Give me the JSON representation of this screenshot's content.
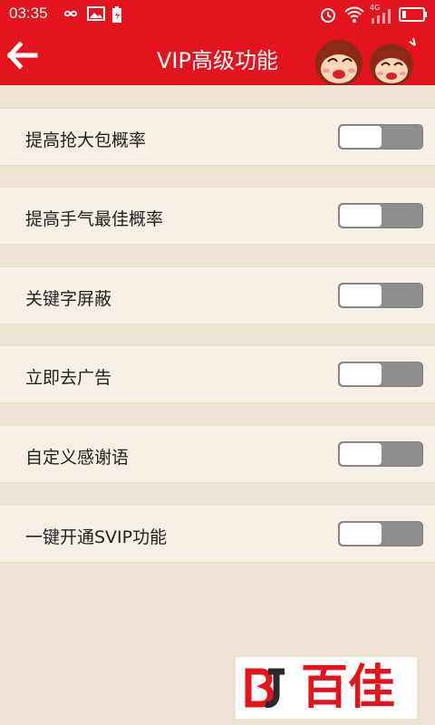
{
  "status_bar": {
    "time": "03:35",
    "network_label": "4G",
    "icons": [
      "infinity-icon",
      "image-icon",
      "battery-saver-icon",
      "alarm-icon",
      "wifi-icon",
      "signal-icon",
      "battery-icon"
    ]
  },
  "header": {
    "title": "VIP高级功能",
    "back_icon": "arrow-left-icon",
    "color": "#e3141e"
  },
  "settings": [
    {
      "label": "提高抢大包概率",
      "enabled": false
    },
    {
      "label": "提高手气最佳概率",
      "enabled": false
    },
    {
      "label": "关键字屏蔽",
      "enabled": false
    },
    {
      "label": "立即去广告",
      "enabled": false
    },
    {
      "label": "自定义感谢语",
      "enabled": false
    },
    {
      "label": "一键开通SVIP功能",
      "enabled": false
    }
  ],
  "watermark": {
    "text": "百佳"
  }
}
